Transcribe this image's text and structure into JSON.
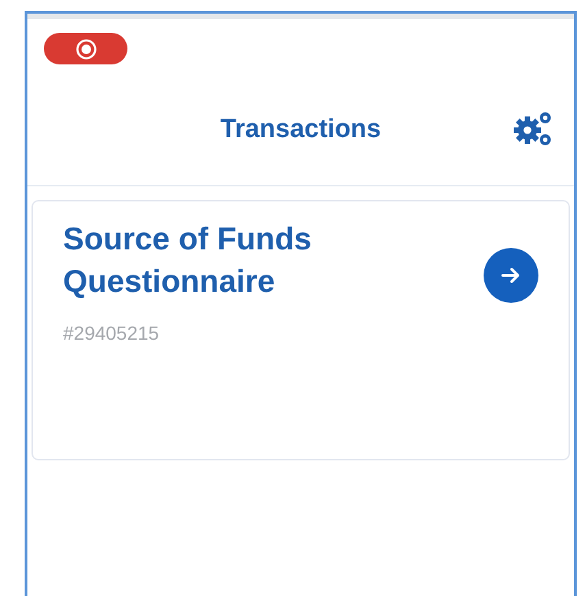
{
  "header": {
    "title": "Transactions"
  },
  "cards": [
    {
      "title": "Source of Funds Questionnaire",
      "number": "#29405215"
    }
  ]
}
